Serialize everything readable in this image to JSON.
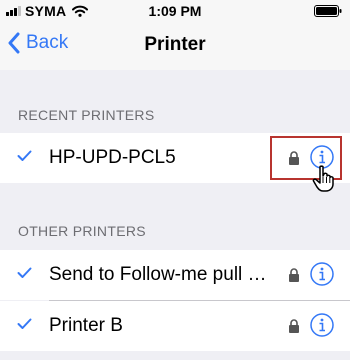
{
  "status": {
    "carrier": "SYMA",
    "time": "1:09 PM"
  },
  "nav": {
    "back_label": "Back",
    "title": "Printer"
  },
  "sections": {
    "recent": "RECENT PRINTERS",
    "other": "OTHER PRINTERS"
  },
  "printers": {
    "recent": [
      {
        "name": "HP-UPD-PCL5"
      }
    ],
    "other": [
      {
        "name": "Send to Follow-me pull queue"
      },
      {
        "name": "Printer B"
      }
    ]
  },
  "colors": {
    "accent": "#3478f6",
    "highlight": "#b8342f"
  },
  "icons": [
    "checkmark-icon",
    "lock-icon",
    "info-icon",
    "hand-pointer-cursor",
    "chevron-left-icon",
    "wifi-icon",
    "battery-icon",
    "signal-icon"
  ]
}
